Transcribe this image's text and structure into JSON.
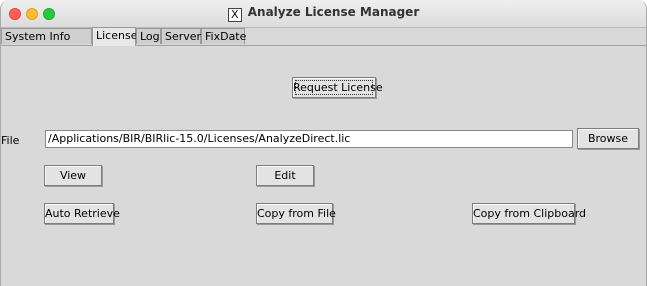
{
  "window": {
    "title": "Analyze License Manager"
  },
  "tabs": [
    {
      "label": "System Info"
    },
    {
      "label": "License"
    },
    {
      "label": "Log"
    },
    {
      "label": "Server"
    },
    {
      "label": "FixDate"
    }
  ],
  "active_tab": "License",
  "license": {
    "request_label": "Request License",
    "file_label": "File",
    "file_value": "/Applications/BIR/BIRlic-15.0/Licenses/AnalyzeDirect.lic",
    "browse_label": "Browse",
    "view_label": "View",
    "edit_label": "Edit",
    "auto_retrieve_label": "Auto Retrieve",
    "copy_from_file_label": "Copy from File",
    "copy_from_clipboard_label": "Copy from Clipboard"
  }
}
